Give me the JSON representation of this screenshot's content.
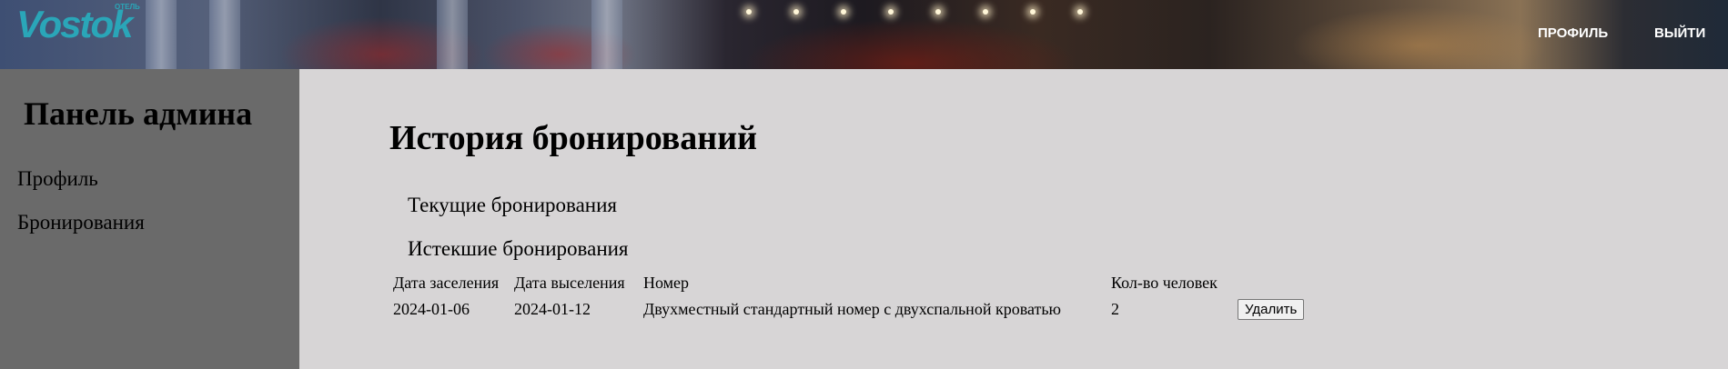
{
  "header": {
    "logo_text": "Vostok",
    "logo_small": "ОТЕЛЬ",
    "nav": {
      "profile": "ПРОФИЛЬ",
      "logout": "ВЫЙТИ"
    }
  },
  "sidebar": {
    "title": "Панель админа",
    "items": [
      {
        "label": "Профиль"
      },
      {
        "label": "Бронирования"
      }
    ]
  },
  "main": {
    "title": "История бронирований",
    "tabs": [
      {
        "label": "Текущие бронирования"
      },
      {
        "label": "Истекшие бронирования"
      }
    ],
    "table": {
      "headers": [
        "Дата заселения",
        "Дата выселения",
        "Номер",
        "Кол-во человек"
      ],
      "rows": [
        {
          "check_in": "2024-01-06",
          "check_out": "2024-01-12",
          "room": "Двухместный стандартный номер с двухспальной кроватью",
          "guests": "2",
          "delete_label": "Удалить"
        }
      ]
    }
  }
}
